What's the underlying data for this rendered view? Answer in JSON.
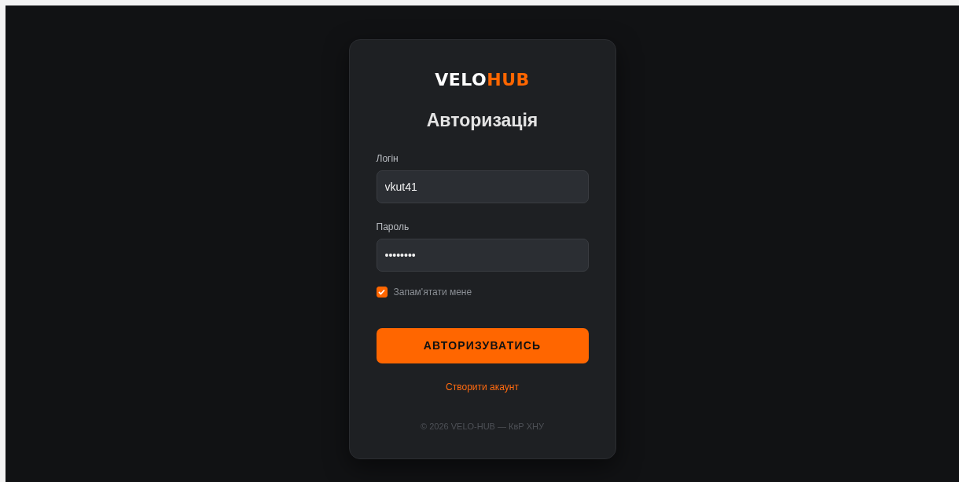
{
  "logo": [
    {
      "text": "VELO",
      "color": "#ffffff"
    },
    {
      "text": "HUB",
      "color": "#ff6600"
    }
  ],
  "title": "Авторизація",
  "fields": [
    {
      "label": "Логін",
      "value": "vkut41"
    },
    {
      "label": "Пароль",
      "value": "••••••••"
    }
  ],
  "remember": {
    "label": "Запам'ятати мене",
    "checked": true
  },
  "submit": "АВТОРИЗУВАТИСЬ",
  "register_link": "Створити акаунт",
  "footer": "© 2026 VELO-HUB — КвР ХНУ"
}
